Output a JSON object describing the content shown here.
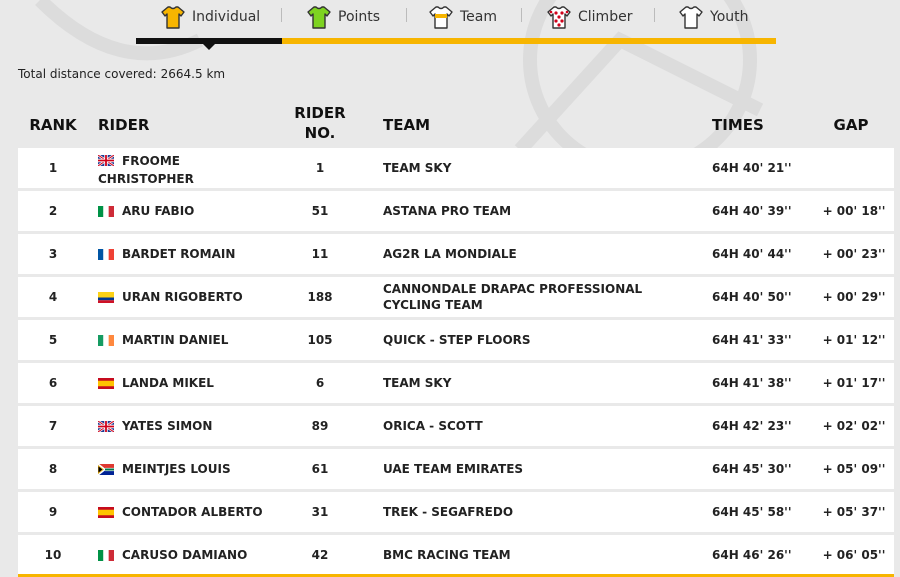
{
  "tabs": [
    {
      "label": "Individual",
      "icon": "yellow-jersey-icon",
      "color": "#f7b500",
      "active": true
    },
    {
      "label": "Points",
      "icon": "green-jersey-icon",
      "color": "#7ed321"
    },
    {
      "label": "Team",
      "icon": "team-jersey-icon",
      "color": "#f7b500"
    },
    {
      "label": "Climber",
      "icon": "polka-dot-jersey-icon",
      "color": "#d0021b"
    },
    {
      "label": "Youth",
      "icon": "white-jersey-icon",
      "color": "#ffffff"
    }
  ],
  "distance": {
    "label": "Total distance covered:",
    "value": "2664.5 km"
  },
  "columns": {
    "rank": "RANK",
    "rider": "RIDER",
    "rider_no": "RIDER\nNO.",
    "team": "TEAM",
    "times": "TIMES",
    "gap": "GAP"
  },
  "riders": [
    {
      "rank": "1",
      "flag": "gb",
      "name": "FROOME CHRISTOPHER",
      "no": "1",
      "team": "TEAM SKY",
      "time": "64H 40' 21''",
      "gap": ""
    },
    {
      "rank": "2",
      "flag": "it",
      "name": "ARU FABIO",
      "no": "51",
      "team": "ASTANA PRO TEAM",
      "time": "64H 40' 39''",
      "gap": "+ 00' 18''"
    },
    {
      "rank": "3",
      "flag": "fr",
      "name": "BARDET ROMAIN",
      "no": "11",
      "team": "AG2R LA MONDIALE",
      "time": "64H 40' 44''",
      "gap": "+ 00' 23''"
    },
    {
      "rank": "4",
      "flag": "co",
      "name": "URAN RIGOBERTO",
      "no": "188",
      "team": "CANNONDALE DRAPAC PROFESSIONAL CYCLING TEAM",
      "time": "64H 40' 50''",
      "gap": "+ 00' 29''"
    },
    {
      "rank": "5",
      "flag": "ie",
      "name": "MARTIN DANIEL",
      "no": "105",
      "team": "QUICK - STEP FLOORS",
      "time": "64H 41' 33''",
      "gap": "+ 01' 12''"
    },
    {
      "rank": "6",
      "flag": "es",
      "name": "LANDA MIKEL",
      "no": "6",
      "team": "TEAM SKY",
      "time": "64H 41' 38''",
      "gap": "+ 01' 17''"
    },
    {
      "rank": "7",
      "flag": "gb",
      "name": "YATES SIMON",
      "no": "89",
      "team": "ORICA - SCOTT",
      "time": "64H 42' 23''",
      "gap": "+ 02' 02''"
    },
    {
      "rank": "8",
      "flag": "za",
      "name": "MEINTJES LOUIS",
      "no": "61",
      "team": "UAE TEAM EMIRATES",
      "time": "64H 45' 30''",
      "gap": "+ 05' 09''"
    },
    {
      "rank": "9",
      "flag": "es",
      "name": "CONTADOR ALBERTO",
      "no": "31",
      "team": "TREK - SEGAFREDO",
      "time": "64H 45' 58''",
      "gap": "+ 05' 37''"
    },
    {
      "rank": "10",
      "flag": "it",
      "name": "CARUSO DAMIANO",
      "no": "42",
      "team": "BMC RACING TEAM",
      "time": "64H 46' 26''",
      "gap": "+ 06' 05''"
    }
  ]
}
